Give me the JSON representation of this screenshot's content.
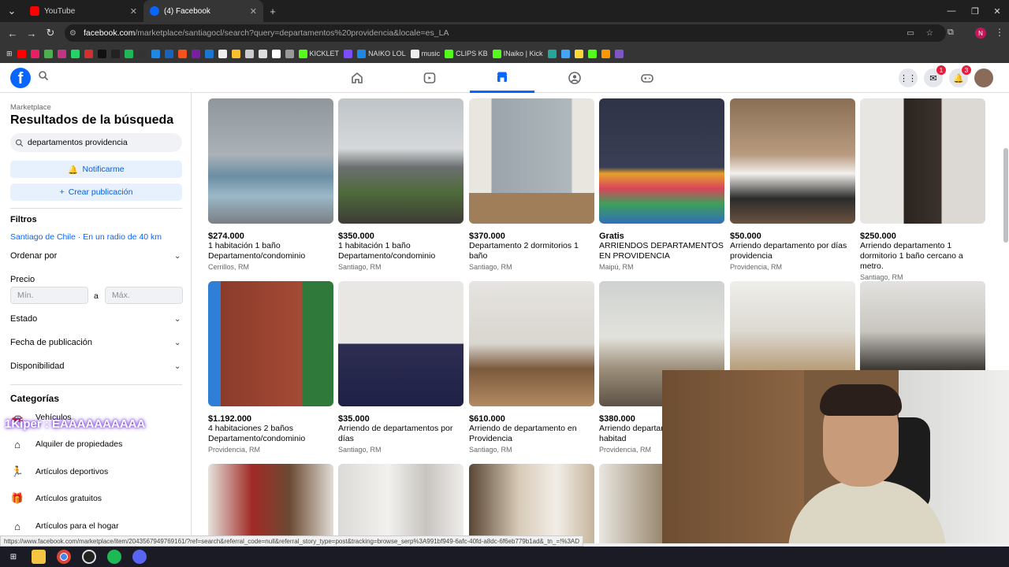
{
  "browser": {
    "tabs": [
      {
        "label": "YouTube",
        "color": "#ff0000"
      },
      {
        "label": "(4) Facebook",
        "color": "#0866ff"
      }
    ],
    "new_tab": "+",
    "url_host": "facebook.com",
    "url_path": "/marketplace/santiagocl/search?query=departamentos%20providencia&locale=es_LA",
    "profile_initial": "N",
    "bookmarks": [
      "",
      "",
      "",
      "",
      "",
      "",
      "",
      "",
      "",
      "",
      "",
      "",
      "",
      "",
      "",
      "",
      "",
      "",
      "",
      "",
      "",
      "",
      "",
      "",
      "KICKLET",
      "",
      "NAIKO LOL",
      "music",
      "CLIPS KB",
      "INaiko | Kick",
      "",
      "",
      "",
      "",
      ""
    ]
  },
  "fb": {
    "logo": "f",
    "badges": {
      "messenger": "1",
      "notifications": "3"
    }
  },
  "sidebar": {
    "marketplace": "Marketplace",
    "title": "Resultados de la búsqueda",
    "search_value": "departamentos providencia",
    "notify": "Notificarme",
    "create": "Crear publicación",
    "filters": "Filtros",
    "location": "Santiago de Chile · En un radio de 40 km",
    "sort": "Ordenar por",
    "price": "Precio",
    "min_placeholder": "Mín.",
    "max_placeholder": "Máx.",
    "to": "a",
    "state": "Estado",
    "date": "Fecha de publicación",
    "availability": "Disponibilidad",
    "categories_title": "Categorías",
    "categories": [
      "Vehículos",
      "Alquiler de propiedades",
      "Artículos deportivos",
      "Artículos gratuitos",
      "Artículos para el hogar"
    ]
  },
  "listings": [
    {
      "price": "$274.000",
      "title": "1 habitación 1 baño Departamento/condominio",
      "location": "Cerrillos, RM"
    },
    {
      "price": "$350.000",
      "title": "1 habitación 1 baño Departamento/condominio",
      "location": "Santiago, RM"
    },
    {
      "price": "$370.000",
      "title": "Departamento 2 dormitorios 1 baño",
      "location": "Santiago, RM"
    },
    {
      "price": "Gratis",
      "title": "ARRIENDOS DEPARTAMENTOS EN PROVIDENCIA",
      "location": "Maipú, RM"
    },
    {
      "price": "$50.000",
      "title": "Arriendo departamento por días providencia",
      "location": "Providencia, RM"
    },
    {
      "price": "$250.000",
      "title": "Arriendo departamento 1 dormitorio 1 baño cercano a metro.",
      "location": "Santiago, RM"
    },
    {
      "price": "$1.192.000",
      "title": "4 habitaciones 2 baños Departamento/condominio",
      "location": "Providencia, RM"
    },
    {
      "price": "$35.000",
      "title": "Arriendo de departamentos por días",
      "location": "Santiago, RM"
    },
    {
      "price": "$610.000",
      "title": "Arriendo de departamento en Providencia",
      "location": "Santiago, RM"
    },
    {
      "price": "$380.000",
      "title": "Arriendo departar encalada 1 habitad",
      "location": "Providencia, RM"
    }
  ],
  "overlays": {
    "kiper": "1Kiper : EAAAAAAAAAA",
    "status_url": "https://www.facebook.com/marketplace/item/204356794976916​1/?ref=search&referral_code=null&referral_story_type=post&tracking=browse_serp%3A991bf949-6afc-40fd-a8dc-6f6eb779b1ad&_tn_=!%3AD"
  }
}
